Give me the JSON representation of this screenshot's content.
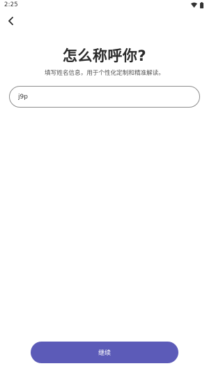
{
  "status_bar": {
    "time": "2:25",
    "icons": [
      "wifi-icon",
      "battery-icon"
    ]
  },
  "header": {
    "back_icon": "chevron-left-icon"
  },
  "main": {
    "title": "怎么称呼你?",
    "subtitle": "填写姓名信息，用于个性化定制和精准解读。",
    "name_input": {
      "value": "j9p",
      "placeholder": ""
    },
    "continue_label": "继续"
  },
  "colors": {
    "accent": "#5c5bb8",
    "input_border": "#8c8c8c",
    "background": "#ffffff"
  }
}
